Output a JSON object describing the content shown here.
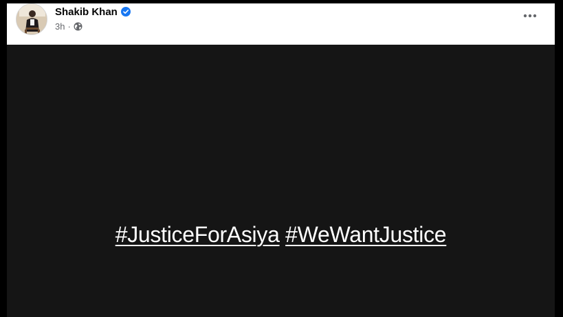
{
  "post": {
    "author": {
      "name": "Shakib Khan",
      "verified_icon": "verified-badge-icon",
      "avatar_icon": "profile-photo"
    },
    "timestamp": "3h",
    "separator": "·",
    "audience_icon": "globe-icon",
    "more_icon": "more-options-icon",
    "media": {
      "background": "#151515",
      "hashtags": [
        "#JusticeForAsiya",
        "#WeWantJustice"
      ]
    }
  },
  "colors": {
    "verified_blue": "#1877f2",
    "meta_gray": "#65676b",
    "name_black": "#050505",
    "outer_black": "#000000"
  }
}
